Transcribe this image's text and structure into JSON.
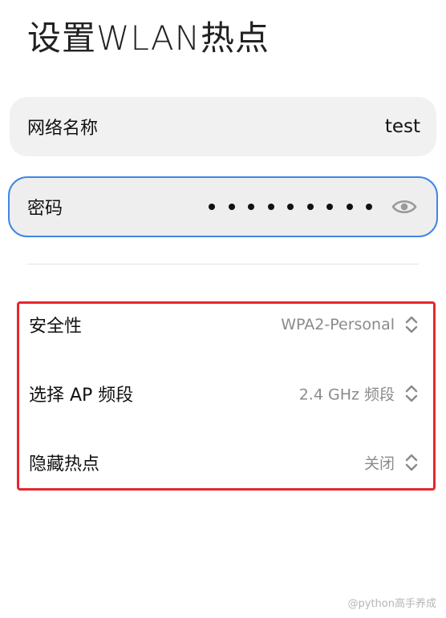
{
  "page": {
    "title": "设置WLAN热点"
  },
  "ssid": {
    "label": "网络名称",
    "value": "test"
  },
  "password": {
    "label": "密码",
    "masked_length": 9,
    "visibility_icon": "eye-icon"
  },
  "settings": {
    "security": {
      "label": "安全性",
      "value": "WPA2-Personal"
    },
    "band": {
      "label": "选择 AP 频段",
      "value": "2.4 GHz 频段"
    },
    "hidden": {
      "label": "隐藏热点",
      "value": "关闭"
    }
  },
  "colors": {
    "focus_border": "#3e86e6",
    "highlight_border": "#e8262d",
    "card_background": "#f1f1f1",
    "secondary_text": "#8a8a8a"
  },
  "watermark": {
    "text": "@python高手养成"
  }
}
